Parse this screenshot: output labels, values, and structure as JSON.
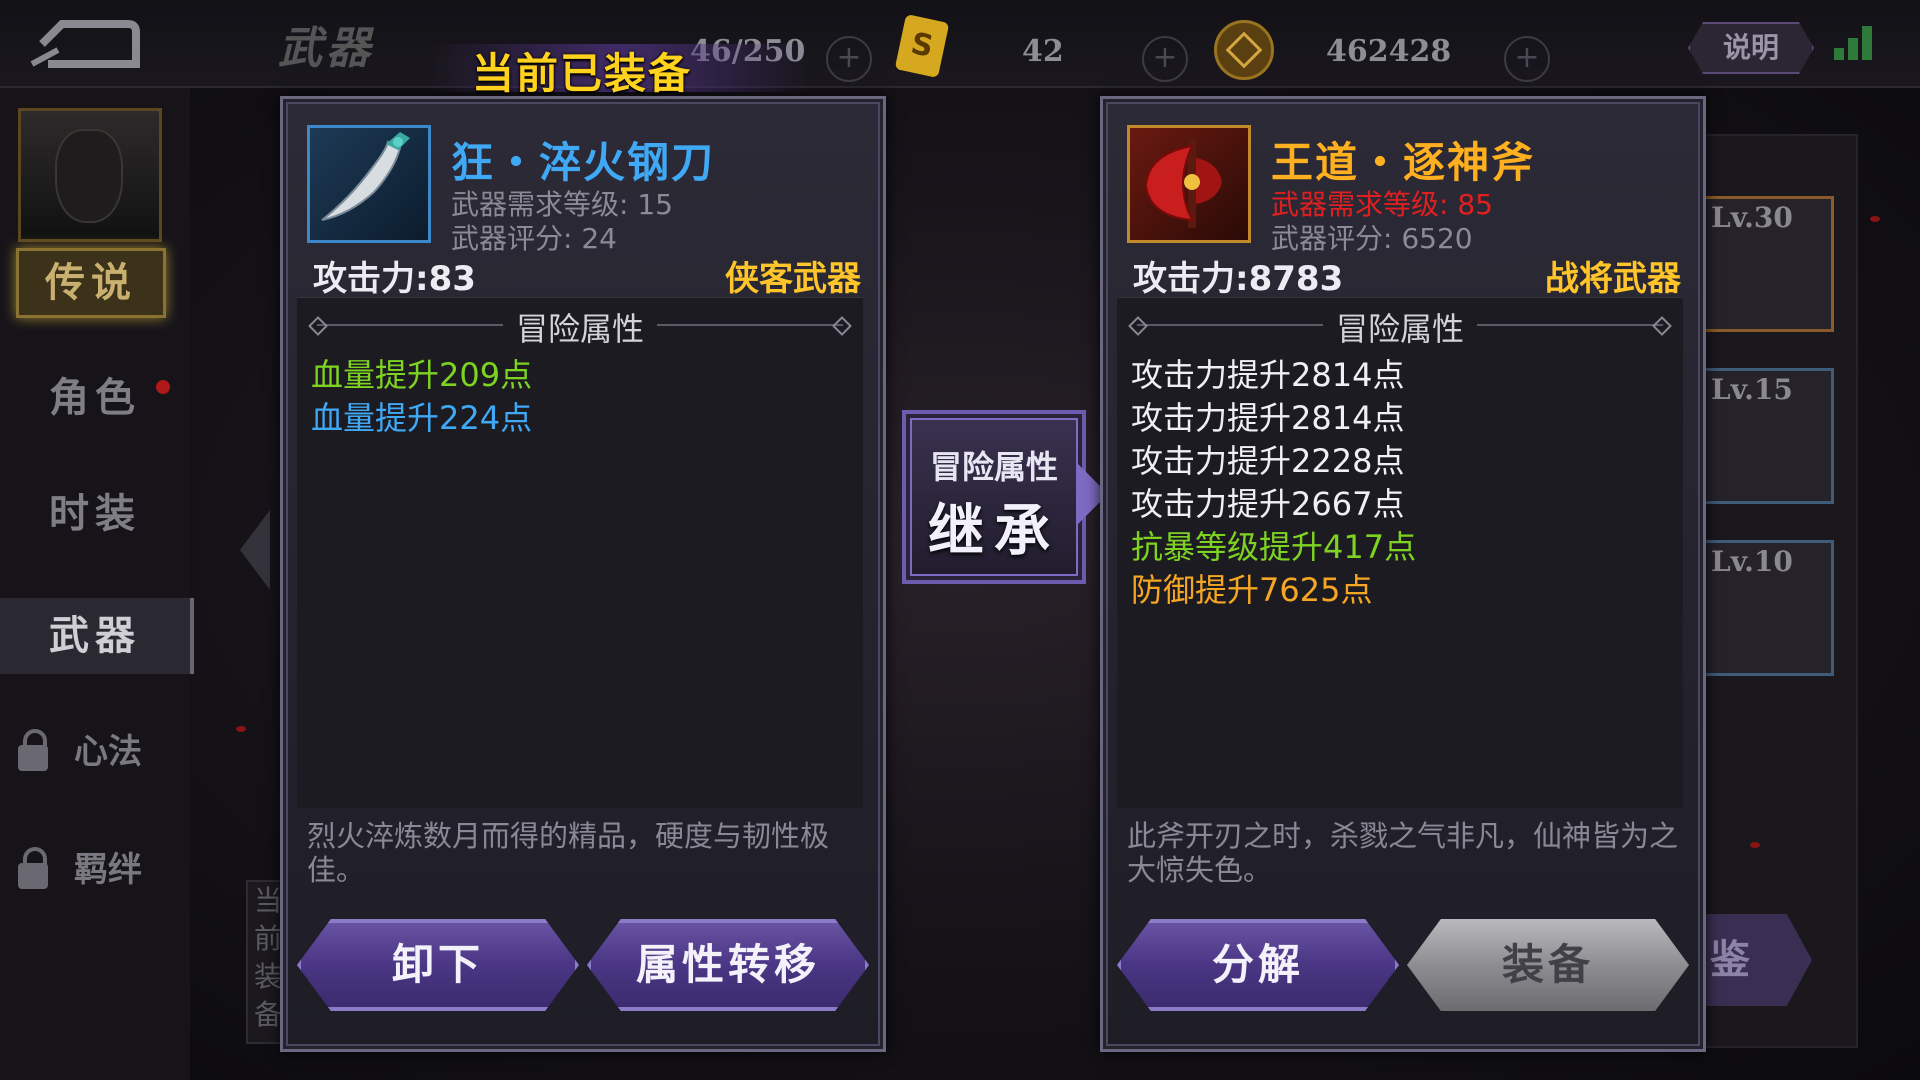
{
  "topbar": {
    "title": "武器",
    "bag_count": "46/250",
    "card_icon_text": "S",
    "currency1": "42",
    "currency2": "462428",
    "help_label": "说明",
    "plus": "+"
  },
  "sidebar": {
    "badge": "传说",
    "items": [
      {
        "label": "角色",
        "dot": true
      },
      {
        "label": "时装"
      },
      {
        "label": "武器",
        "active": true
      },
      {
        "label": "心法",
        "locked": true
      },
      {
        "label": "羁绊",
        "locked": true
      }
    ]
  },
  "background": {
    "slots": [
      "Lv.30",
      "Lv.15",
      "Lv.10"
    ],
    "left_text": "当前装备",
    "right_button": "鉴"
  },
  "equipped_label": "当前已装备",
  "left_item": {
    "name": "狂・淬火钢刀",
    "name_color": "#3fa9f5",
    "required_level": "武器需求等级: 15",
    "score": "武器评分: 24",
    "attack": "攻击力:83",
    "weapon_class": "侠客武器",
    "attr_title": "冒险属性",
    "attributes": [
      {
        "text": "血量提升209点",
        "color": "#7ed321"
      },
      {
        "text": "血量提升224点",
        "color": "#3fa9f5"
      }
    ],
    "description": "烈火淬炼数月而得的精品，硬度与韧性极佳。",
    "buttons": {
      "unequip": "卸下",
      "transfer": "属性转移"
    }
  },
  "inherit": {
    "top": "冒险属性",
    "main": "继承"
  },
  "right_item": {
    "name": "王道・逐神斧",
    "name_color": "#ffb020",
    "required_level": "武器需求等级: 85",
    "required_level_color": "#e02020",
    "score": "武器评分: 6520",
    "attack": "攻击力:8783",
    "weapon_class": "战将武器",
    "attr_title": "冒险属性",
    "attributes": [
      {
        "text": "攻击力提升2814点",
        "color": "#f0f0f4"
      },
      {
        "text": "攻击力提升2814点",
        "color": "#f0f0f4"
      },
      {
        "text": "攻击力提升2228点",
        "color": "#f0f0f4"
      },
      {
        "text": "攻击力提升2667点",
        "color": "#f0f0f4"
      },
      {
        "text": "抗暴等级提升417点",
        "color": "#7ed321"
      },
      {
        "text": "防御提升7625点",
        "color": "#f5a623"
      }
    ],
    "description": "此斧开刃之时，杀戮之气非凡，仙神皆为之大惊失色。",
    "buttons": {
      "dismantle": "分解",
      "equip": "装备"
    }
  }
}
